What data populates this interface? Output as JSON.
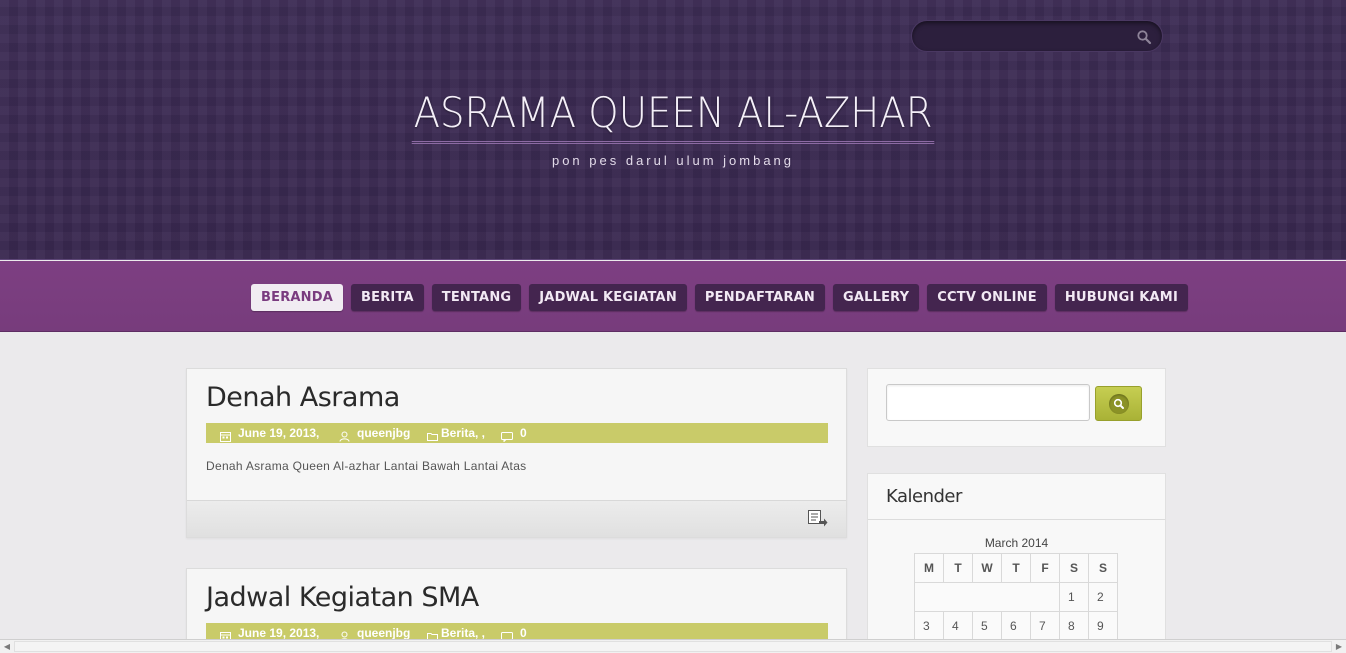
{
  "header": {
    "site_title": "ASRAMA QUEEN AL-AZHAR",
    "site_description": "pon pes darul ulum jombang",
    "search": {
      "value": "",
      "icon": "search-icon"
    }
  },
  "nav": {
    "items": [
      {
        "label": "BERANDA",
        "active": true
      },
      {
        "label": "BERITA"
      },
      {
        "label": "TENTANG"
      },
      {
        "label": "JADWAL KEGIATAN"
      },
      {
        "label": "PENDAFTARAN"
      },
      {
        "label": "GALLERY"
      },
      {
        "label": "CCTV ONLINE"
      },
      {
        "label": "HUBUNGI KAMI"
      }
    ]
  },
  "posts": [
    {
      "title": "Denah Asrama",
      "date": "June 19, 2013,",
      "author": "queenjbg",
      "category": "Berita, ,",
      "comments": "0",
      "excerpt": "Denah Asrama Queen Al-azhar Lantai Bawah Lantai Atas"
    },
    {
      "title": "Jadwal Kegiatan SMA",
      "date": "June 19, 2013,",
      "author": "queenjbg",
      "category": "Berita, ,",
      "comments": "0"
    }
  ],
  "sidebar": {
    "search": {
      "value": ""
    },
    "calendar": {
      "title": "Kalender",
      "caption": "March 2014",
      "days": [
        "M",
        "T",
        "W",
        "T",
        "F",
        "S",
        "S"
      ],
      "row1": [
        "",
        "",
        "",
        "",
        "",
        "1",
        "2"
      ],
      "row2": [
        "3",
        "4",
        "5",
        "6",
        "7",
        "8",
        "9"
      ]
    }
  },
  "colors": {
    "header_bg": "#3b2a51",
    "nav_bg": "#7d3f82",
    "nav_item_bg": "#44254f",
    "meta_bar": "#c9cb69",
    "accent_active": "#7a3b7f"
  }
}
